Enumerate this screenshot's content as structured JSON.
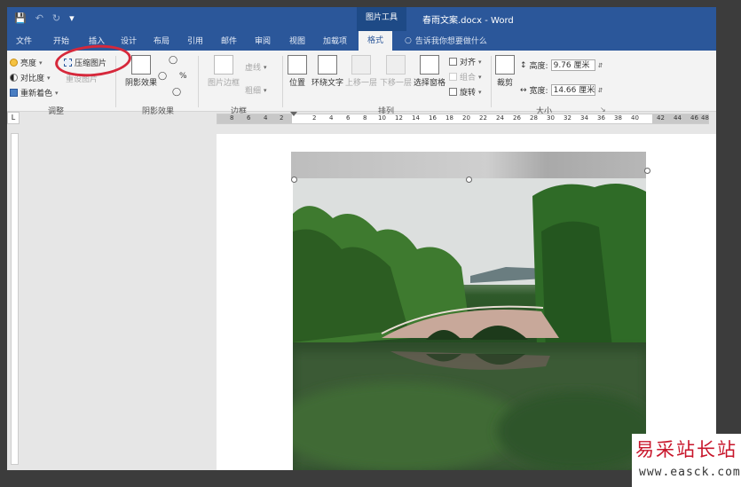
{
  "titlebar": {
    "quick_access": [
      "save-icon",
      "undo-icon",
      "redo-icon",
      "customize-icon"
    ],
    "context_tool": "图片工具",
    "doc_title": "春雨文案.docx - Word"
  },
  "tabs": {
    "items": [
      "文件",
      "开始",
      "插入",
      "设计",
      "布局",
      "引用",
      "邮件",
      "审阅",
      "视图",
      "加载项",
      "格式"
    ],
    "active": "格式",
    "tellme": "告诉我你想要做什么"
  },
  "ribbon": {
    "adjust": {
      "brightness": "亮度",
      "contrast": "对比度",
      "recolor": "重新着色",
      "compress": "压缩图片",
      "reset": "重设图片",
      "label": "调整"
    },
    "effects": {
      "shadow": "阴影效果",
      "label": "阴影效果"
    },
    "border": {
      "border_btn": "图片边框",
      "dashes": "虚线",
      "weight": "粗细",
      "label": "边框"
    },
    "arrange": {
      "position": "位置",
      "wrap": "环绕文字",
      "forward": "上移一层",
      "backward": "下移一层",
      "selection": "选择窗格",
      "align": "对齐",
      "group": "组合",
      "rotate": "旋转",
      "label": "排列"
    },
    "size": {
      "crop": "裁剪",
      "height_label": "高度:",
      "height_value": "9.76 厘米",
      "width_label": "宽度:",
      "width_value": "14.66 厘米",
      "label": "大小"
    }
  },
  "ruler": {
    "ticks": [
      "8",
      "6",
      "4",
      "2",
      "2",
      "4",
      "6",
      "8",
      "10",
      "12",
      "14",
      "16",
      "18",
      "20",
      "22",
      "24",
      "26",
      "28",
      "30",
      "32",
      "34",
      "36",
      "38",
      "40",
      "42",
      "44",
      "46",
      "48"
    ],
    "corner": "L"
  },
  "watermark": {
    "cn": "易采站长站",
    "url": "www.easck.com"
  }
}
